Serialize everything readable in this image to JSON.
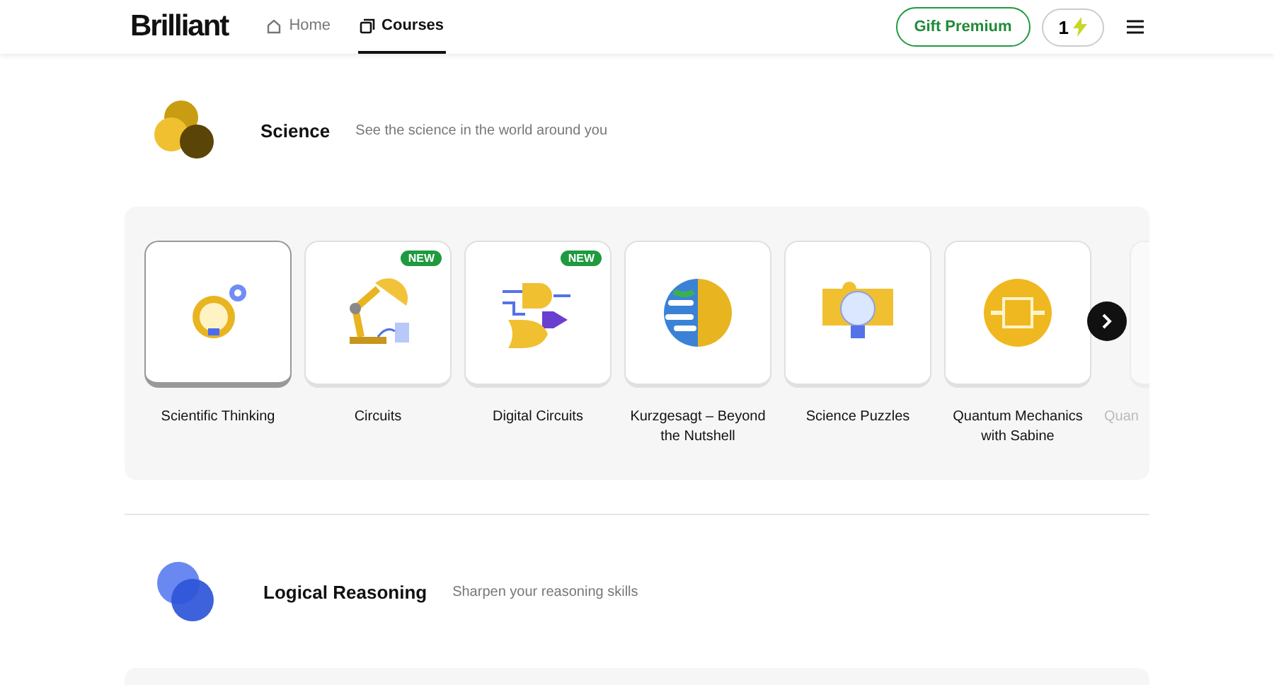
{
  "header": {
    "logo": "Brilliant",
    "nav": [
      {
        "label": "Home",
        "selected": false
      },
      {
        "label": "Courses",
        "selected": true
      }
    ],
    "gift_button": "Gift Premium",
    "streak": "1"
  },
  "sections": [
    {
      "title": "Science",
      "subtitle": "See the science in the world around you",
      "courses": [
        {
          "label": "Scientific Thinking",
          "selected": true,
          "new": false
        },
        {
          "label": "Circuits",
          "selected": false,
          "new": true,
          "badge": "NEW"
        },
        {
          "label": "Digital Circuits",
          "selected": false,
          "new": true,
          "badge": "NEW"
        },
        {
          "label": "Kurzgesagt – Beyond the Nutshell",
          "selected": false,
          "new": false
        },
        {
          "label": "Science Puzzles",
          "selected": false,
          "new": false
        },
        {
          "label": "Quantum Mechanics with Sabine",
          "selected": false,
          "new": false
        },
        {
          "label": "Quan",
          "selected": false,
          "new": false
        }
      ]
    },
    {
      "title": "Logical Reasoning",
      "subtitle": "Sharpen your reasoning skills"
    }
  ]
}
